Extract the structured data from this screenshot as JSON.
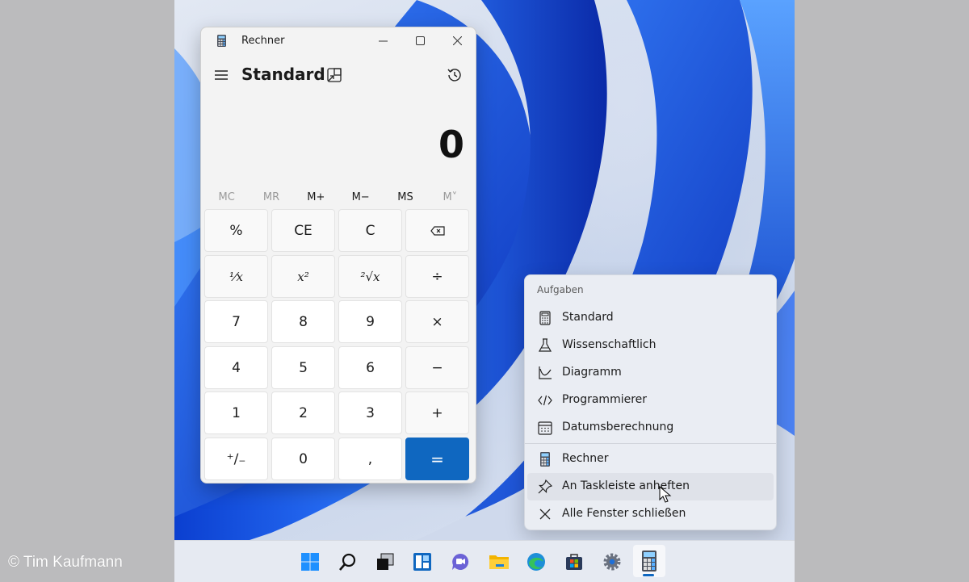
{
  "credit": "© Tim Kaufmann",
  "window": {
    "title": "Rechner",
    "mode": "Standard",
    "display_value": "0",
    "minimize_glyph": "—",
    "maximize_glyph": "☐",
    "close_glyph": "✕"
  },
  "memory": [
    "MC",
    "MR",
    "M+",
    "M−",
    "MS",
    "M˅"
  ],
  "keys": {
    "percent": "%",
    "ce": "CE",
    "c": "C",
    "reciprocal": "¹⁄x",
    "square": "x²",
    "sqrt": "²√x",
    "divide": "÷",
    "seven": "7",
    "eight": "8",
    "nine": "9",
    "multiply": "×",
    "four": "4",
    "five": "5",
    "six": "6",
    "minus": "−",
    "one": "1",
    "two": "2",
    "three": "3",
    "plus": "+",
    "negate": "⁺∕₋",
    "zero": "0",
    "comma": ",",
    "equals": "="
  },
  "jumplist": {
    "header": "Aufgaben",
    "tasks": [
      "Standard",
      "Wissenschaftlich",
      "Diagramm",
      "Programmierer",
      "Datumsberechnung"
    ],
    "app": "Rechner",
    "pin": "An Taskleiste anheften",
    "close_all": "Alle Fenster schließen"
  },
  "taskbar_icons": [
    "start-icon",
    "search-icon",
    "task-view-icon",
    "widgets-icon",
    "chat-icon",
    "file-explorer-icon",
    "edge-icon",
    "store-icon",
    "settings-icon",
    "calculator-icon"
  ],
  "colors": {
    "accent": "#0f67c0",
    "wallpaper_blue": "#1a5de0"
  }
}
